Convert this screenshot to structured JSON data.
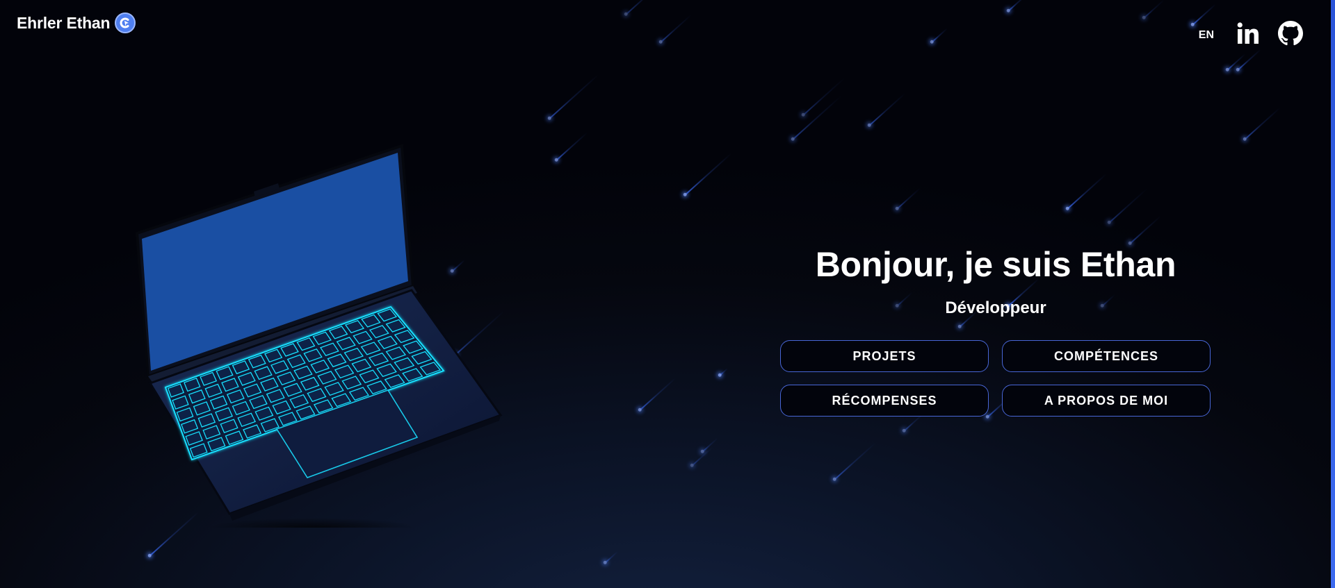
{
  "header": {
    "brand_name": "Ehrler Ethan",
    "brand_logo_icon": "cursor-logo-icon",
    "language_toggle": "EN",
    "social": [
      {
        "name": "linkedin-icon"
      },
      {
        "name": "github-icon"
      }
    ]
  },
  "hero": {
    "title": "Bonjour, je suis Ethan",
    "subtitle": "Développeur",
    "buttons": {
      "projects": "PROJETS",
      "skills": "COMPÉTENCES",
      "awards": "RÉCOMPENSES",
      "about": "A PROPOS DE MOI"
    }
  },
  "illustration": {
    "name": "laptop-illustration",
    "screen_color": "#1a4fa3",
    "keyboard_glow_color": "#18e0ff"
  },
  "colors": {
    "background": "#05070f",
    "accent": "#4866d6",
    "streak": "#3c6eff"
  }
}
